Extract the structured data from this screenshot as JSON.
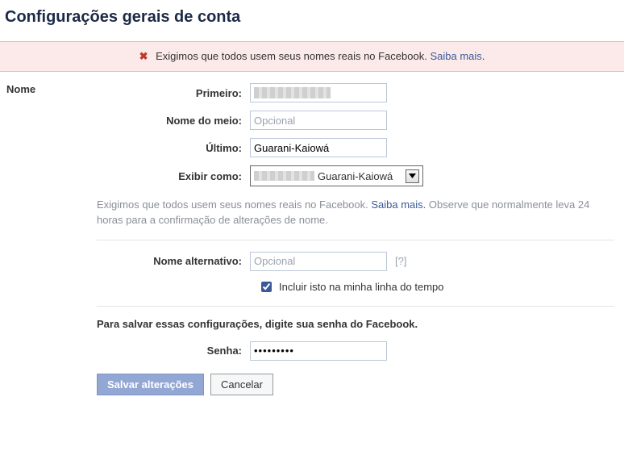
{
  "page": {
    "title": "Configurações gerais de conta"
  },
  "notice": {
    "text": "Exigimos que todos usem seus nomes reais no Facebook.",
    "link": "Saiba mais",
    "dot": "."
  },
  "section": {
    "label": "Nome"
  },
  "fields": {
    "first": {
      "label": "Primeiro:",
      "value": ""
    },
    "middle": {
      "label": "Nome do meio:",
      "placeholder": "Opcional",
      "value": ""
    },
    "last": {
      "label": "Último:",
      "value": "Guarani-Kaiowá"
    },
    "display": {
      "label": "Exibir como:",
      "value": "Guarani-Kaiowá"
    },
    "note_a": "Exigimos que todos usem seus nomes reais no Facebook. ",
    "note_link": "Saiba mais.",
    "note_b": " Observe que normalmente leva 24 horas para a confirmação de alterações de nome.",
    "alt": {
      "label": "Nome alternativo:",
      "placeholder": "Opcional",
      "value": "",
      "help": "[?]"
    },
    "timeline_check": {
      "label": "Incluir isto na minha linha do tempo",
      "checked": true
    },
    "save_prompt": "Para salvar essas configurações, digite sua senha do Facebook.",
    "password": {
      "label": "Senha:",
      "value": "•••••••••"
    }
  },
  "buttons": {
    "save": "Salvar alterações",
    "cancel": "Cancelar"
  }
}
